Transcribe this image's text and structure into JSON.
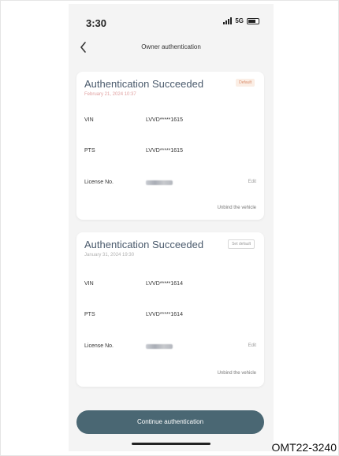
{
  "status_bar": {
    "time": "3:30",
    "network": "5G"
  },
  "nav": {
    "title": "Owner authentication"
  },
  "cards": [
    {
      "title": "Authentication Succeeded",
      "date": "February 21, 2024 10:37",
      "badge": "Default",
      "rows": [
        {
          "label": "VIN",
          "value": "LVVD*****1615"
        },
        {
          "label": "PTS",
          "value": "LVVD*****1615"
        }
      ],
      "license_label": "License No.",
      "edit_label": "Edit",
      "unbind_label": "Unbind the vehicle"
    },
    {
      "title": "Authentication Succeeded",
      "date": "January 31, 2024 19:30",
      "badge": "Set default",
      "rows": [
        {
          "label": "VIN",
          "value": "LVVD*****1614"
        },
        {
          "label": "PTS",
          "value": "LVVD*****1614"
        }
      ],
      "license_label": "License No.",
      "edit_label": "Edit",
      "unbind_label": "Unbind the vehicle"
    }
  ],
  "cta": {
    "label": "Continue authentication"
  },
  "footer_code": "OMT22-3240"
}
